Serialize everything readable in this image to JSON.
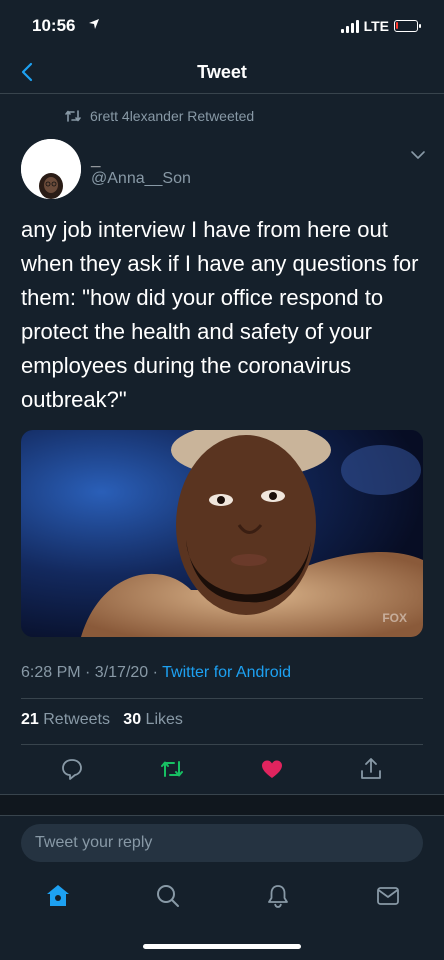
{
  "status_bar": {
    "time": "10:56",
    "network": "LTE",
    "battery_level": 0.12,
    "battery_color": "#ff3b30"
  },
  "nav": {
    "title": "Tweet",
    "back_icon": "chevron-left-icon"
  },
  "tweet": {
    "retweeted_by": "6rett 4lexander Retweeted",
    "author_name": "_",
    "author_handle": "@Anna__Son",
    "text": "any job interview I have from here out when they ask if I have any questions for them: \"how did your office respond to protect the health and safety of your employees during the coronavirus outbreak?\"",
    "media_watermark": "FOX",
    "timestamp": "6:28 PM · 3/17/20 · ",
    "source": "Twitter for Android",
    "retweets_count": "21",
    "retweets_label": "Retweets",
    "likes_count": "30",
    "likes_label": "Likes"
  },
  "actions": {
    "reply_icon": "reply-icon",
    "retweet_icon": "retweet-icon",
    "like_icon": "heart-icon",
    "share_icon": "share-icon",
    "retweet_color": "#17bf63",
    "like_color": "#e0245e"
  },
  "reply": {
    "placeholder": "Tweet your reply"
  },
  "tab_bar": {
    "items": [
      "home-icon",
      "search-icon",
      "notifications-icon",
      "messages-icon"
    ],
    "active_color": "#1da1f2"
  },
  "colors": {
    "background": "#15202b",
    "secondary_text": "#8899a6",
    "accent": "#1da1f2"
  }
}
